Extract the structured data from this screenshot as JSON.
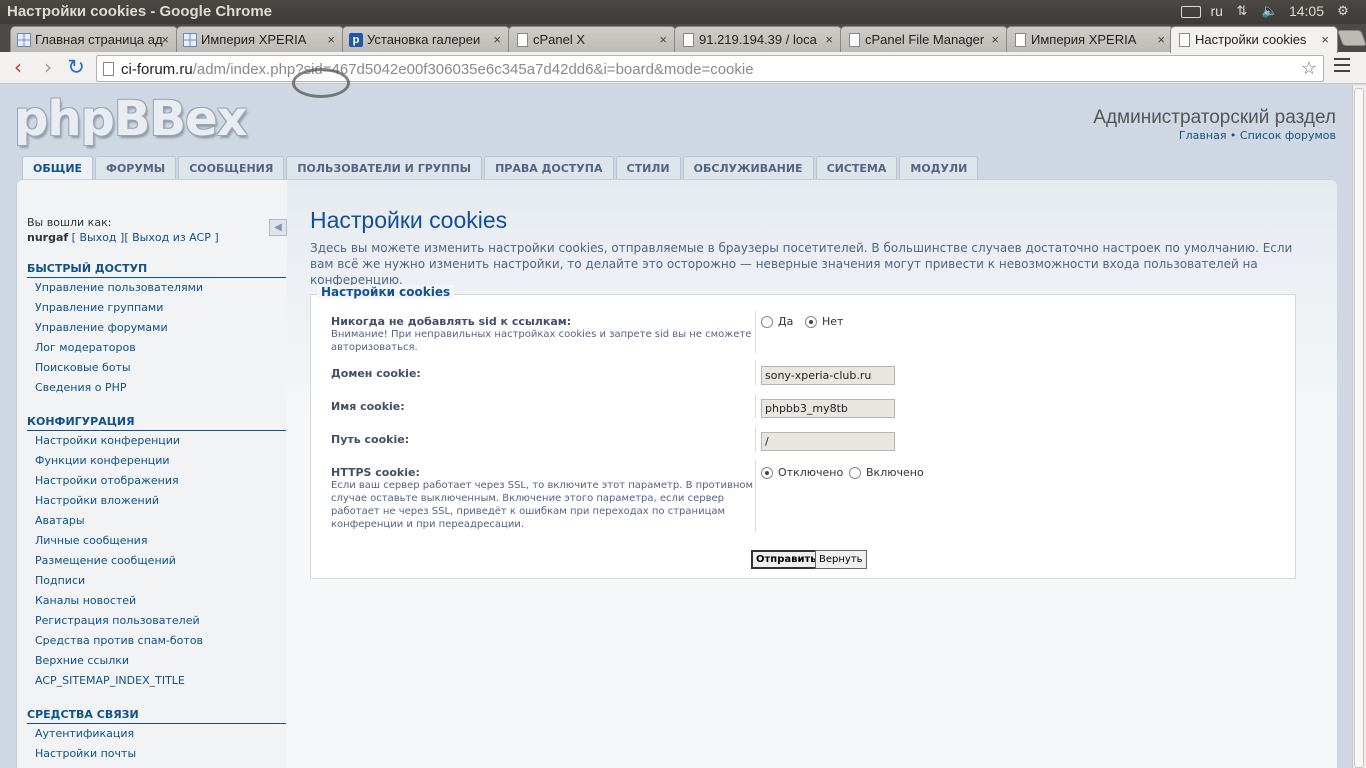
{
  "os": {
    "window_title": "Настройки cookies - Google Chrome",
    "keyboard_layout": "ru",
    "clock": "14:05"
  },
  "tabs": [
    {
      "label": "Главная страница ад",
      "icon": "grid-favicon"
    },
    {
      "label": "Империя XPERIA",
      "icon": "grid-favicon"
    },
    {
      "label": "Установка галереи",
      "icon": "p-favicon"
    },
    {
      "label": "cPanel X",
      "icon": "page-favicon"
    },
    {
      "label": "91.219.194.39 / loca",
      "icon": "page-favicon"
    },
    {
      "label": "cPanel File Manager",
      "icon": "page-favicon"
    },
    {
      "label": "Империя XPERIA",
      "icon": "page-favicon"
    },
    {
      "label": "Настройки cookies",
      "icon": "page-favicon",
      "active": true
    }
  ],
  "address": {
    "host": "ci-forum.ru",
    "path": "/adm/index.php?sid=467d5042e00f306035e6c345a7d42dd6&i=board&mode=cookie"
  },
  "header": {
    "logo": "phpBBex",
    "acp_title": "Администраторский раздел",
    "link_home": "Главная",
    "link_sep": " • ",
    "link_forums": "Список форумов"
  },
  "main_tabs": [
    "ОБЩИЕ",
    "ФОРУМЫ",
    "СООБЩЕНИЯ",
    "ПОЛЬЗОВАТЕЛИ И ГРУППЫ",
    "ПРАВА ДОСТУПА",
    "СТИЛИ",
    "ОБСЛУЖИВАНИЕ",
    "СИСТЕМА",
    "МОДУЛИ"
  ],
  "sidebar": {
    "logged_in_label": "Вы вошли как:",
    "username": "nurgaf",
    "logout": "[ Выход ]",
    "logout_acp": "[ Выход из ACP ]",
    "collapse_icon": "◀",
    "sections": [
      {
        "title": "Быстрый доступ",
        "items": [
          "Управление пользователями",
          "Управление группами",
          "Управление форумами",
          "Лог модераторов",
          "Поисковые боты",
          "Сведения о PHP"
        ]
      },
      {
        "title": "Конфигурация",
        "items": [
          "Настройки конференции",
          "Функции конференции",
          "Настройки отображения",
          "Настройки вложений",
          "Аватары",
          "Личные сообщения",
          "Размещение сообщений",
          "Подписи",
          "Каналы новостей",
          "Регистрация пользователей",
          "Средства против спам-ботов",
          "Верхние ссылки",
          "ACP_SITEMAP_INDEX_TITLE"
        ]
      },
      {
        "title": "Средства связи",
        "items": [
          "Аутентификация",
          "Настройки почты"
        ]
      }
    ]
  },
  "content": {
    "title": "Настройки cookies",
    "description": "Здесь вы можете изменить настройки cookies, отправляемые в браузеры посетителей. В большинстве случаев достаточно настроек по умолчанию. Если вам всё же нужно изменить настройки, то делайте это осторожно — неверные значения могут привести к невозможности входа пользователей на конференцию.",
    "legend": "Настройки cookies",
    "fields": {
      "no_sid": {
        "label": "Никогда не добавлять sid к ссылкам:",
        "help": "Внимание! При неправильных настройках cookies и запрете sid вы не сможете авторизоваться.",
        "opt_yes": "Да",
        "opt_no": "Нет",
        "selected": "no"
      },
      "domain": {
        "label": "Домен cookie:",
        "value": "sony-xperia-club.ru"
      },
      "name": {
        "label": "Имя cookie:",
        "value": "phpbb3_my8tb"
      },
      "path": {
        "label": "Путь cookie:",
        "value": "/"
      },
      "https": {
        "label": "HTTPS cookie:",
        "help": "Если ваш сервер работает через SSL, то включите этот параметр. В противном случае оставьте выключенным. Включение этого параметра, если сервер работает не через SSL, приведёт к ошибкам при переходах по страницам конференции и при переадресации.",
        "opt_off": "Отключено",
        "opt_on": "Включено",
        "selected": "off"
      }
    },
    "submit": "Отправить",
    "reset": "Вернуть"
  }
}
